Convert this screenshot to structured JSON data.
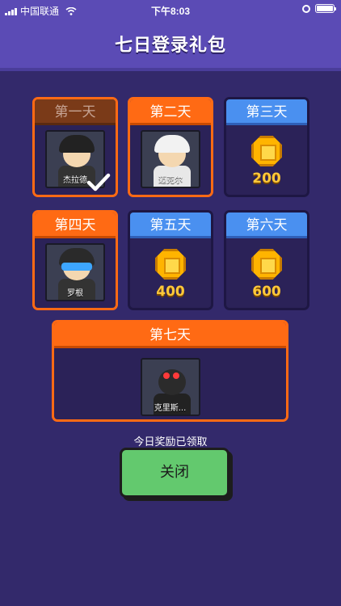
{
  "status_bar": {
    "carrier": "中国联通",
    "time": "下午8:03"
  },
  "header": {
    "title": "七日登录礼包"
  },
  "days": [
    {
      "label": "第一天",
      "type": "hero",
      "hero_name": "杰拉德",
      "claimed": true
    },
    {
      "label": "第二天",
      "type": "hero",
      "hero_name": "迈克尔",
      "claimed": false
    },
    {
      "label": "第三天",
      "type": "coin",
      "amount": "200",
      "claimed": false
    },
    {
      "label": "第四天",
      "type": "hero",
      "hero_name": "罗根",
      "claimed": false
    },
    {
      "label": "第五天",
      "type": "coin",
      "amount": "400",
      "claimed": false
    },
    {
      "label": "第六天",
      "type": "coin",
      "amount": "600",
      "claimed": false
    },
    {
      "label": "第七天",
      "type": "hero",
      "hero_name": "克里斯...",
      "claimed": false
    }
  ],
  "status_message": "今日奖励已领取",
  "close_button": "关闭",
  "colors": {
    "background": "#33296b",
    "header": "#5b4bb5",
    "blue_tab": "#4a90f0",
    "orange_tab": "#ff6a14",
    "coin": "#ffb400",
    "close_button": "#63c96e"
  }
}
